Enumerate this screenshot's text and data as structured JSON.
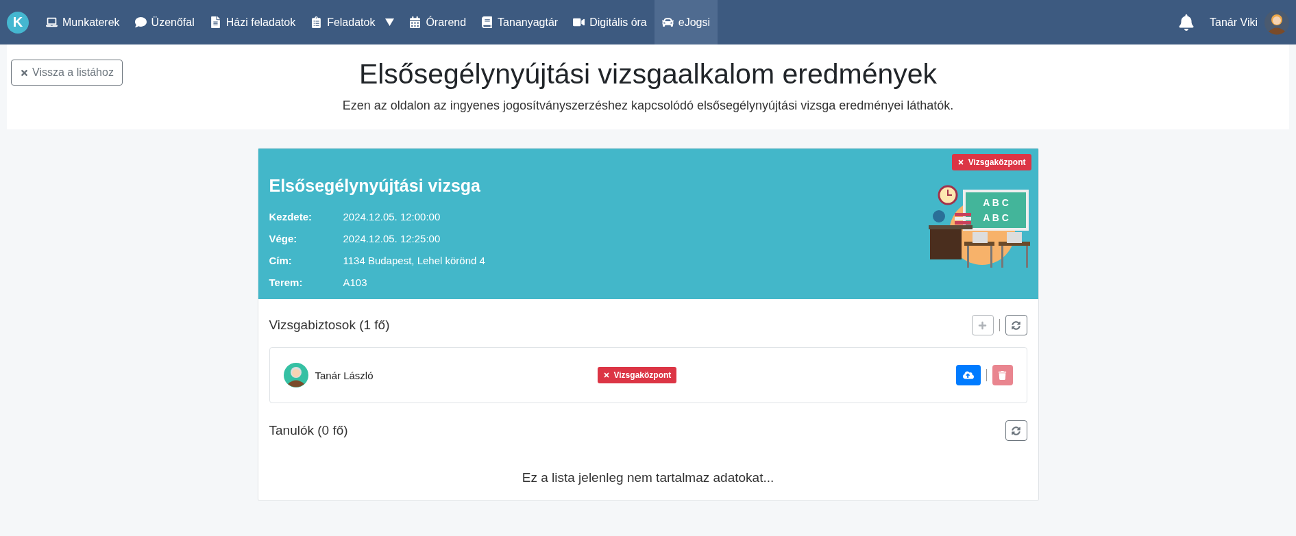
{
  "navbar": {
    "logo": "K",
    "items": [
      {
        "label": "Munkaterek",
        "selected": false,
        "dropdown": false
      },
      {
        "label": "Üzenőfal",
        "selected": false,
        "dropdown": false
      },
      {
        "label": "Házi feladatok",
        "selected": false,
        "dropdown": false
      },
      {
        "label": "Feladatok",
        "selected": false,
        "dropdown": true
      },
      {
        "label": "Órarend",
        "selected": false,
        "dropdown": false
      },
      {
        "label": "Tananyagtár",
        "selected": false,
        "dropdown": false
      },
      {
        "label": "Digitális óra",
        "selected": false,
        "dropdown": false
      },
      {
        "label": "eJogsi",
        "selected": true,
        "dropdown": false
      }
    ],
    "user": "Tanár Viki"
  },
  "header": {
    "back_button": "Vissza a listához",
    "title": "Elsősegélynyújtási vizsgaalkalom eredmények",
    "subtitle": "Ezen az oldalon az ingyenes jogosítványszerzéshez kapcsolódó elsősegélynyújtási vizsga eredményei láthatók."
  },
  "exam": {
    "badge": "Vizsgaközpont",
    "title": "Elsősegélynyújtási vizsga",
    "board_text": [
      "A B C",
      "A B C"
    ],
    "fields": [
      {
        "label": "Kezdete:",
        "value": "2024.12.05. 12:00:00"
      },
      {
        "label": "Vége:",
        "value": "2024.12.05. 12:25:00"
      },
      {
        "label": "Cím:",
        "value": "1134 Budapest, Lehel körönd 4"
      },
      {
        "label": "Terem:",
        "value": "A103"
      }
    ]
  },
  "examiners": {
    "title": "Vizsgabiztosok (1 fő)",
    "add_disabled": true,
    "rows": [
      {
        "name": "Tanár László",
        "badge": "Vizsgaközpont",
        "delete_disabled": true
      }
    ]
  },
  "students": {
    "title": "Tanulók (0 fő)",
    "empty_text": "Ez a lista jelenleg nem tartalmaz adatokat..."
  }
}
